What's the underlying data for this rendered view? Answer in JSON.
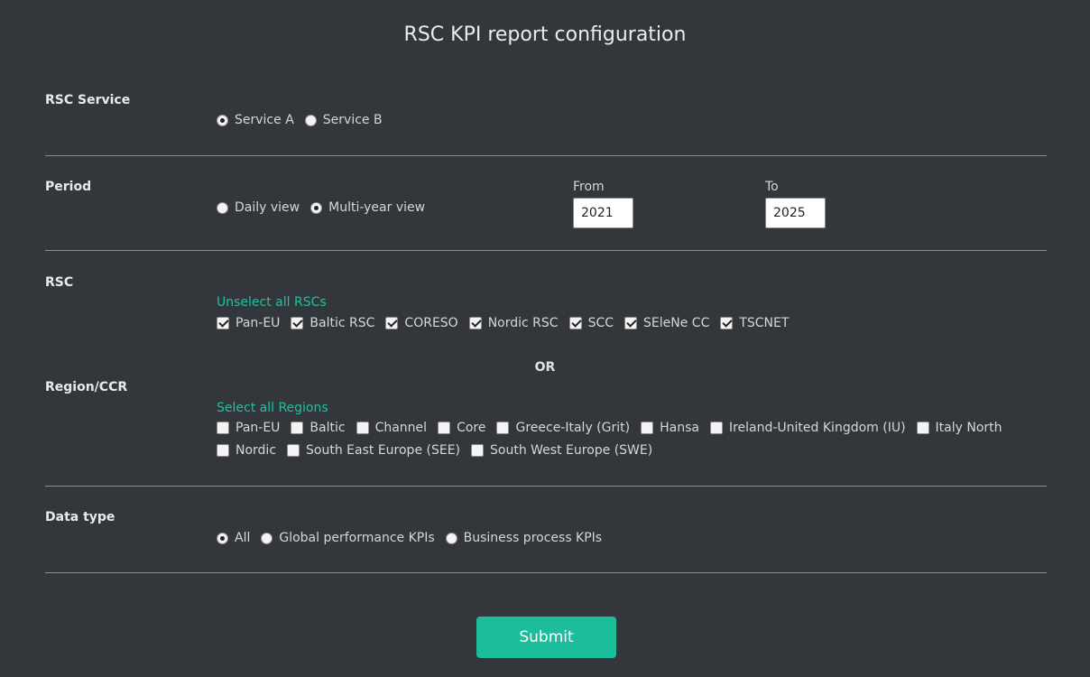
{
  "title": "RSC KPI report configuration",
  "service": {
    "label": "RSC Service",
    "options": [
      {
        "label": "Service A",
        "selected": true
      },
      {
        "label": "Service B",
        "selected": false
      }
    ]
  },
  "period": {
    "label": "Period",
    "options": [
      {
        "label": "Daily view",
        "selected": false
      },
      {
        "label": "Multi-year view",
        "selected": true
      }
    ],
    "from_label": "From",
    "from_value": "2021",
    "to_label": "To",
    "to_value": "2025"
  },
  "rsc": {
    "label": "RSC",
    "toggle_link": "Unselect all RSCs",
    "items": [
      {
        "label": "Pan-EU",
        "checked": true
      },
      {
        "label": "Baltic RSC",
        "checked": true
      },
      {
        "label": "CORESO",
        "checked": true
      },
      {
        "label": "Nordic RSC",
        "checked": true
      },
      {
        "label": "SCC",
        "checked": true
      },
      {
        "label": "SEleNe CC",
        "checked": true
      },
      {
        "label": "TSCNET",
        "checked": true
      }
    ]
  },
  "or_label": "OR",
  "region": {
    "label": "Region/CCR",
    "toggle_link": "Select all Regions",
    "row1": [
      {
        "label": "Pan-EU",
        "checked": false
      },
      {
        "label": "Baltic",
        "checked": false
      },
      {
        "label": "Channel",
        "checked": false
      },
      {
        "label": "Core",
        "checked": false
      },
      {
        "label": "Greece-Italy (Grit)",
        "checked": false
      },
      {
        "label": "Hansa",
        "checked": false
      },
      {
        "label": "Ireland-United Kingdom (IU)",
        "checked": false
      },
      {
        "label": "Italy North",
        "checked": false
      }
    ],
    "row2": [
      {
        "label": "Nordic",
        "checked": false
      },
      {
        "label": "South East Europe (SEE)",
        "checked": false
      },
      {
        "label": "South West Europe (SWE)",
        "checked": false
      }
    ]
  },
  "data_type": {
    "label": "Data type",
    "options": [
      {
        "label": "All",
        "selected": true
      },
      {
        "label": "Global performance KPIs",
        "selected": false
      },
      {
        "label": "Business process KPIs",
        "selected": false
      }
    ]
  },
  "submit_label": "Submit",
  "colors": {
    "background": "#33373c",
    "accent": "#1bbd9b",
    "link": "#1fc1a0"
  }
}
